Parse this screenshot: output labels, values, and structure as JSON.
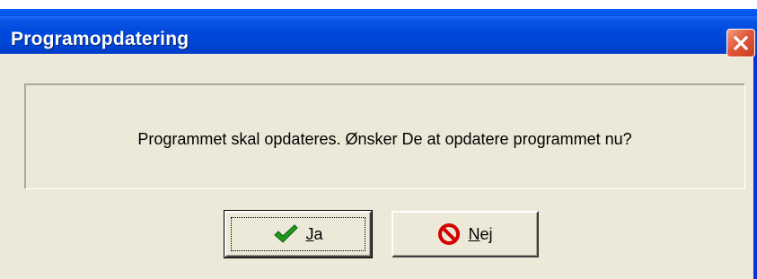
{
  "window": {
    "title": "Programopdatering"
  },
  "message": {
    "text": "Programmet skal opdateres. Ønsker De at opdatere programmet nu?"
  },
  "buttons": {
    "yes_mnemonic": "J",
    "yes_rest": "a",
    "yes_icon": "checkmark-icon",
    "no_mnemonic": "N",
    "no_rest": "ej",
    "no_icon": "prohibited-icon"
  },
  "colors": {
    "title_bar": "#0045d6",
    "close_button": "#e2583a",
    "dialog_bg": "#ece9d8",
    "check_green": "#1e9b1e",
    "prohibit_red": "#d40000"
  }
}
